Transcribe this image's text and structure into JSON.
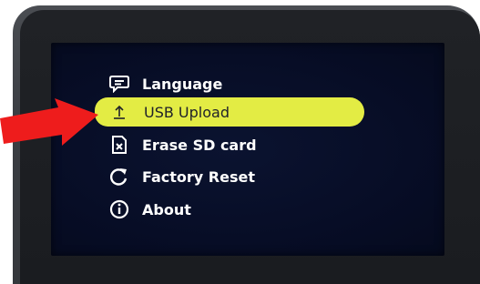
{
  "menu": {
    "items": [
      {
        "label": "Language",
        "icon": "speech-bubble-icon",
        "selected": false
      },
      {
        "label": "USB Upload",
        "icon": "upload-icon",
        "selected": true
      },
      {
        "label": "Erase SD card",
        "icon": "sd-card-erase-icon",
        "selected": false
      },
      {
        "label": "Factory Reset",
        "icon": "reset-arrow-icon",
        "selected": false
      },
      {
        "label": "About",
        "icon": "info-icon",
        "selected": false
      }
    ]
  },
  "colors": {
    "highlight": "#e3ec44",
    "screen_bg": "#070d26",
    "text": "#ffffff",
    "arrow": "#ee1c1c"
  }
}
